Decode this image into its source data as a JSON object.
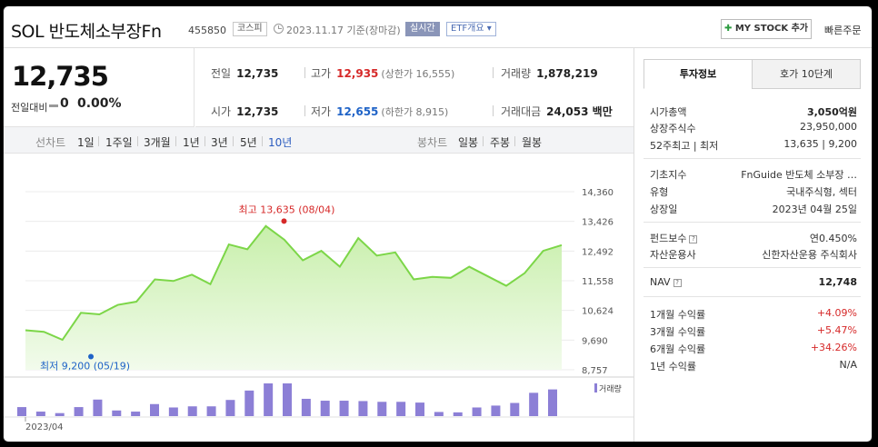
{
  "header": {
    "name": "SOL 반도체소부장Fn",
    "code": "455850",
    "market": "코스피",
    "date_text": "2023.11.17 기준(장마감)",
    "realtime": "실시간",
    "etf_overview": "ETF개요",
    "mystock": "MY STOCK 추가",
    "quick_order": "빠른주문"
  },
  "summary": {
    "price": "12,735",
    "change_label": "전일대비",
    "change": "0",
    "change_pct": "0.00%"
  },
  "stats": {
    "prev_close_label": "전일",
    "prev_close": "12,735",
    "high_label": "고가",
    "high": "12,935",
    "upper_limit": "(상한가 16,555)",
    "volume_label": "거래량",
    "volume": "1,878,219",
    "open_label": "시가",
    "open": "12,735",
    "low_label": "저가",
    "low": "12,655",
    "lower_limit": "(하한가 8,915)",
    "amount_label": "거래대금",
    "amount": "24,053 백만"
  },
  "periods": {
    "line_chart": "선차트",
    "ranges": [
      "1일",
      "1주일",
      "3개월",
      "1년",
      "3년",
      "5년",
      "10년"
    ],
    "active": "10년",
    "candle_chart": "봉차트",
    "candles": [
      "일봉",
      "주봉",
      "월봉"
    ]
  },
  "chart_data": {
    "type": "area",
    "xlabel": "",
    "ylabel": "",
    "x_start_label": "2023/04",
    "y_ticks": [
      "14,360",
      "13,426",
      "12,492",
      "11,558",
      "10,624",
      "9,690",
      "8,757"
    ],
    "ylim": [
      8757,
      14360
    ],
    "values": [
      10000,
      9950,
      9700,
      10550,
      10500,
      10800,
      10900,
      11600,
      11550,
      11750,
      11450,
      12700,
      12550,
      13280,
      12850,
      12200,
      12500,
      12000,
      12900,
      12350,
      12450,
      11600,
      11680,
      11650,
      12000,
      11700,
      11400,
      11800,
      12500,
      12680
    ],
    "volumes": [
      2.4,
      1.2,
      0.8,
      2.4,
      4.4,
      1.5,
      1.2,
      3.2,
      2.3,
      2.6,
      2.6,
      4.3,
      6.8,
      8.7,
      8.7,
      4.6,
      4.1,
      4.1,
      4.0,
      3.8,
      3.8,
      3.6,
      1.1,
      1.0,
      2.3,
      2.8,
      3.5,
      6.2,
      7.1
    ],
    "high_annotation": "최고 13,635 (08/04)",
    "high_point": {
      "index": 13,
      "value": 13635
    },
    "low_annotation": "최저 9,200 (05/19)",
    "low_point": {
      "index": 3,
      "value": 9200
    },
    "volume_legend": "거래량",
    "colors": {
      "line": "#7cd648",
      "fill_top": "#c8efab",
      "fill_bottom": "#f2fbec",
      "bar": "#8c7fd6",
      "high": "#d62929",
      "low": "#1f63c7"
    }
  },
  "side": {
    "tab_active": "투자정보",
    "tab_other": "호가 10단계",
    "rows": [
      {
        "label": "시가총액",
        "value": "3,050억원",
        "bold": true
      },
      {
        "label": "상장주식수",
        "value": "23,950,000"
      },
      {
        "label": "52주최고 | 최저",
        "value": "13,635 | 9,200"
      }
    ],
    "rows2": [
      {
        "label": "기초지수",
        "value": "FnGuide 반도체 소부장 …"
      },
      {
        "label": "유형",
        "value": "국내주식형, 섹터"
      },
      {
        "label": "상장일",
        "value": "2023년 04월 25일"
      }
    ],
    "rows3": [
      {
        "label": "펀드보수",
        "value": "연0.450%"
      },
      {
        "label": "자산운용사",
        "value": "신한자산운용 주식회사"
      }
    ],
    "nav_label": "NAV",
    "nav_value": "12,748",
    "returns": [
      {
        "label": "1개월 수익률",
        "value": "+4.09%"
      },
      {
        "label": "3개월 수익률",
        "value": "+5.47%"
      },
      {
        "label": "6개월 수익률",
        "value": "+34.26%"
      },
      {
        "label": "1년 수익률",
        "value": "N/A"
      }
    ]
  }
}
